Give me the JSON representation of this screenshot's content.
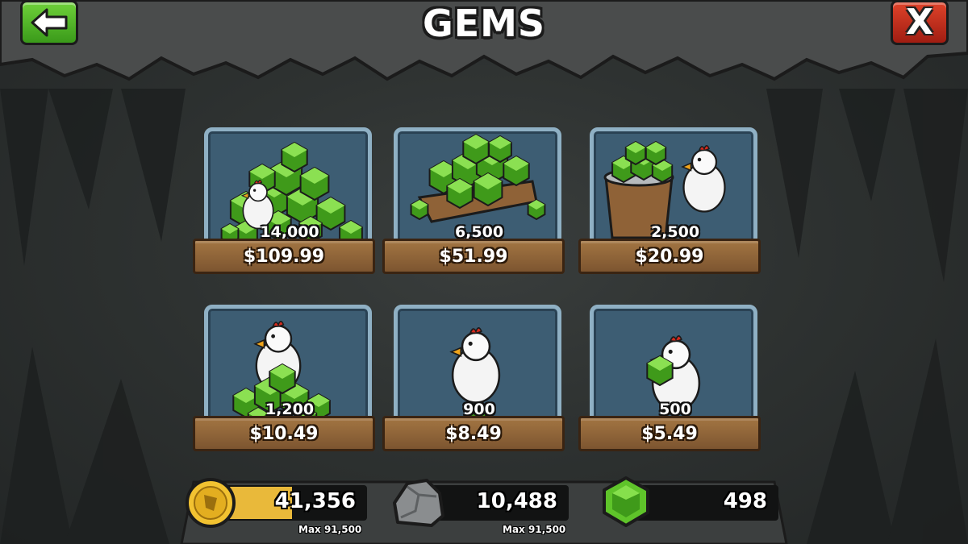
{
  "header": {
    "title": "GEMS",
    "back_icon": "arrow-left-icon",
    "close_label": "X"
  },
  "packs": [
    {
      "amount": "14,000",
      "price": "$109.99",
      "art": "huge-gem-pile-with-chicken"
    },
    {
      "amount": "6,500",
      "price": "$51.99",
      "art": "gem-crate"
    },
    {
      "amount": "2,500",
      "price": "$20.99",
      "art": "gem-bucket-with-chicken"
    },
    {
      "amount": "1,200",
      "price": "$10.49",
      "art": "chicken-on-gem-pile"
    },
    {
      "amount": "900",
      "price": "$8.49",
      "art": "chicken-on-gem"
    },
    {
      "amount": "500",
      "price": "$5.49",
      "art": "chicken-holding-gem"
    }
  ],
  "resources": {
    "coins": {
      "icon": "coin-icon",
      "value": "41,356",
      "max": "Max 91,500",
      "fill": 0.45
    },
    "stone": {
      "icon": "stone-icon",
      "value": "10,488",
      "max": "Max 91,500"
    },
    "gems": {
      "icon": "gem-icon",
      "value": "498"
    }
  },
  "colors": {
    "gem_green": "#5fc42a",
    "back_button": "#4fb527",
    "close_button": "#c0301c",
    "plank": "#8f6237",
    "coin": "#f2c231"
  }
}
